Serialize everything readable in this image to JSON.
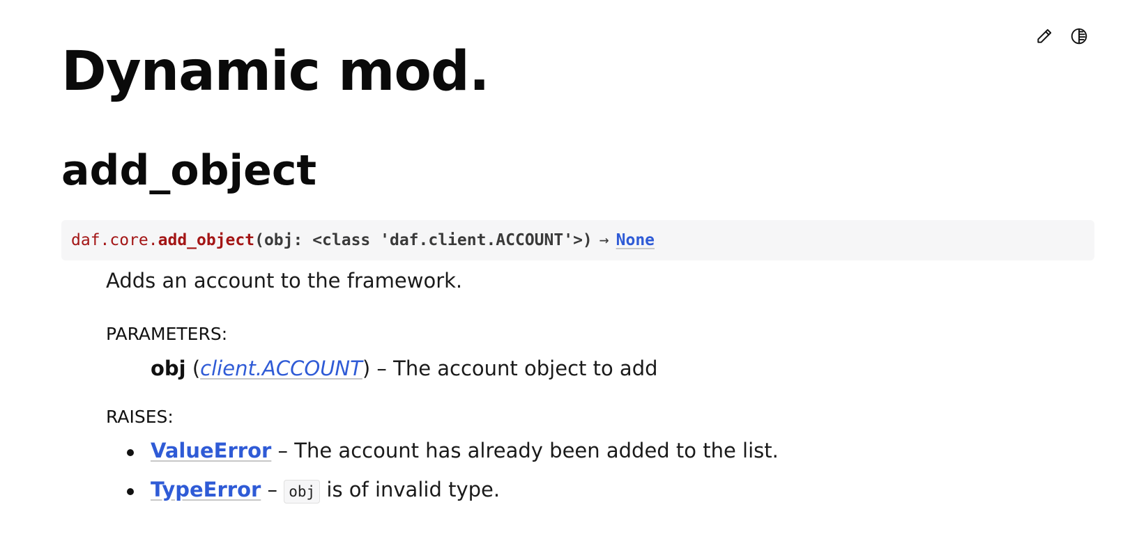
{
  "toolbar": {
    "edit_icon": "pencil-icon",
    "theme_icon": "theme-toggle-icon"
  },
  "page": {
    "title": "Dynamic mod."
  },
  "section": {
    "title": "add_object",
    "signature": {
      "prefix": "daf.core.",
      "name": "add_object",
      "params": "(obj: <class 'daf.client.ACCOUNT'>)",
      "arrow": "→",
      "return_type": "None"
    },
    "description": "Adds an account to the framework.",
    "parameters_label": "PARAMETERS:",
    "parameter": {
      "name": "obj",
      "open_paren": " (",
      "type": "client.ACCOUNT",
      "close_paren": ")",
      "description": " – The account object to add"
    },
    "raises_label": "RAISES:",
    "raises": [
      {
        "exception": "ValueError",
        "separator": " – ",
        "code": "",
        "description": "The account has already been added to the list."
      },
      {
        "exception": "TypeError",
        "separator": " – ",
        "code": "obj",
        "description": " is of invalid type."
      }
    ]
  }
}
